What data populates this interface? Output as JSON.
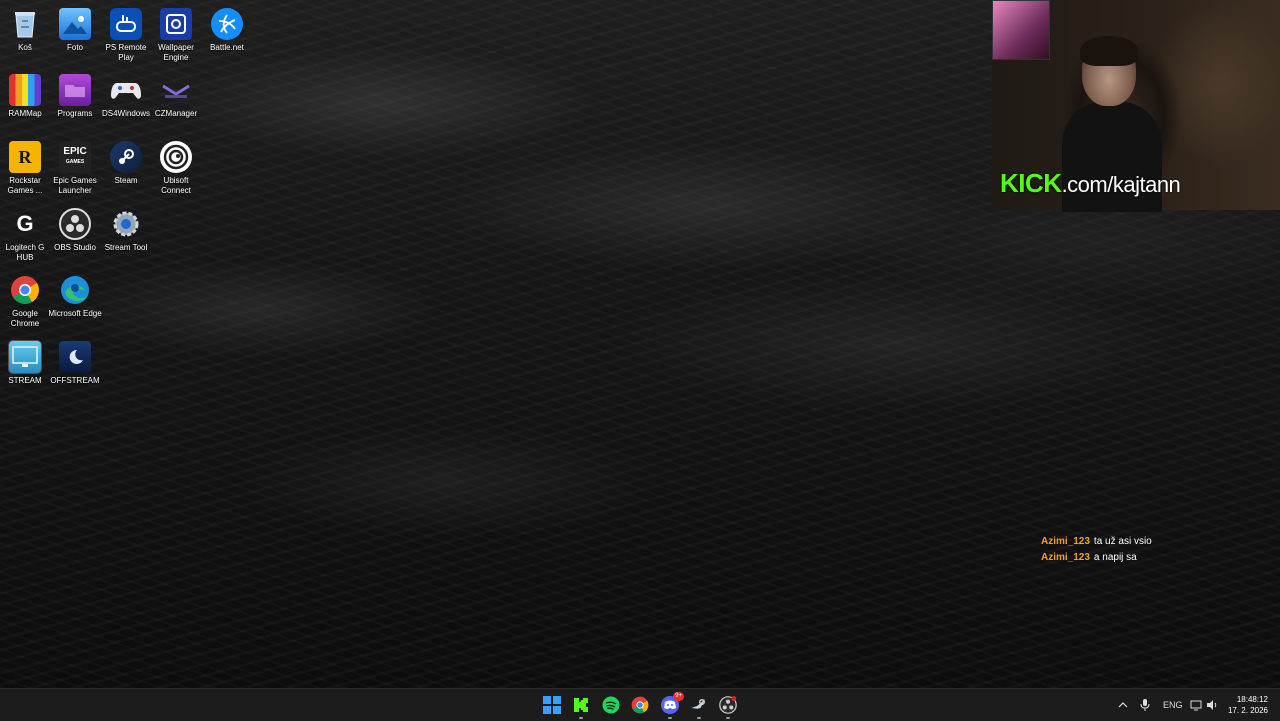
{
  "desktop": {
    "icons": [
      {
        "label": "Koš",
        "icon": "recycle-bin-icon"
      },
      {
        "label": "Foto",
        "icon": "photos-icon"
      },
      {
        "label": "PS Remote Play",
        "icon": "ps-remote-play-icon"
      },
      {
        "label": "Wallpaper Engine",
        "icon": "wallpaper-engine-icon"
      },
      {
        "label": "Battle.net",
        "icon": "battlenet-icon"
      },
      {
        "label": "RAMMap",
        "icon": "rammap-icon"
      },
      {
        "label": "Programs",
        "icon": "programs-folder-icon"
      },
      {
        "label": "DS4Windows",
        "icon": "ds4windows-icon"
      },
      {
        "label": "CZManager",
        "icon": "czmanager-icon"
      },
      {
        "label": "Rockstar Games ...",
        "icon": "rockstar-icon"
      },
      {
        "label": "Epic Games Launcher",
        "icon": "epic-games-icon"
      },
      {
        "label": "Steam",
        "icon": "steam-icon"
      },
      {
        "label": "Ubisoft Connect",
        "icon": "ubisoft-icon"
      },
      {
        "label": "Logitech G HUB",
        "icon": "logitech-icon"
      },
      {
        "label": "OBS Studio",
        "icon": "obs-icon"
      },
      {
        "label": "Stream Tool",
        "icon": "gear-icon"
      },
      {
        "label": "Google Chrome",
        "icon": "chrome-icon"
      },
      {
        "label": "Microsoft Edge",
        "icon": "edge-icon"
      },
      {
        "label": "STREAM",
        "icon": "monitor-icon"
      },
      {
        "label": "OFFSTREAM",
        "icon": "monitor-moon-icon"
      }
    ],
    "epic_glyph": "EPIC",
    "epic_sub": "GAMES",
    "rockstar_glyph": "R",
    "logitech_glyph": "G"
  },
  "overlay": {
    "kick_brand": "KICK",
    "kick_url": ".com/kajtann",
    "brand_color": "#53fc18"
  },
  "chat": [
    {
      "user": "Azimi_123",
      "message": "ta už asi vsio"
    },
    {
      "user": "Azimi_123",
      "message": "a napij sa"
    }
  ],
  "taskbar": {
    "apps": [
      "start-icon",
      "kick-icon",
      "spotify-icon",
      "chrome-icon",
      "discord-icon",
      "steam-icon",
      "obs-icon"
    ],
    "discord_badge": "9+",
    "language": "ENG",
    "time": "18:48:12",
    "date": "17. 2. 2026"
  }
}
